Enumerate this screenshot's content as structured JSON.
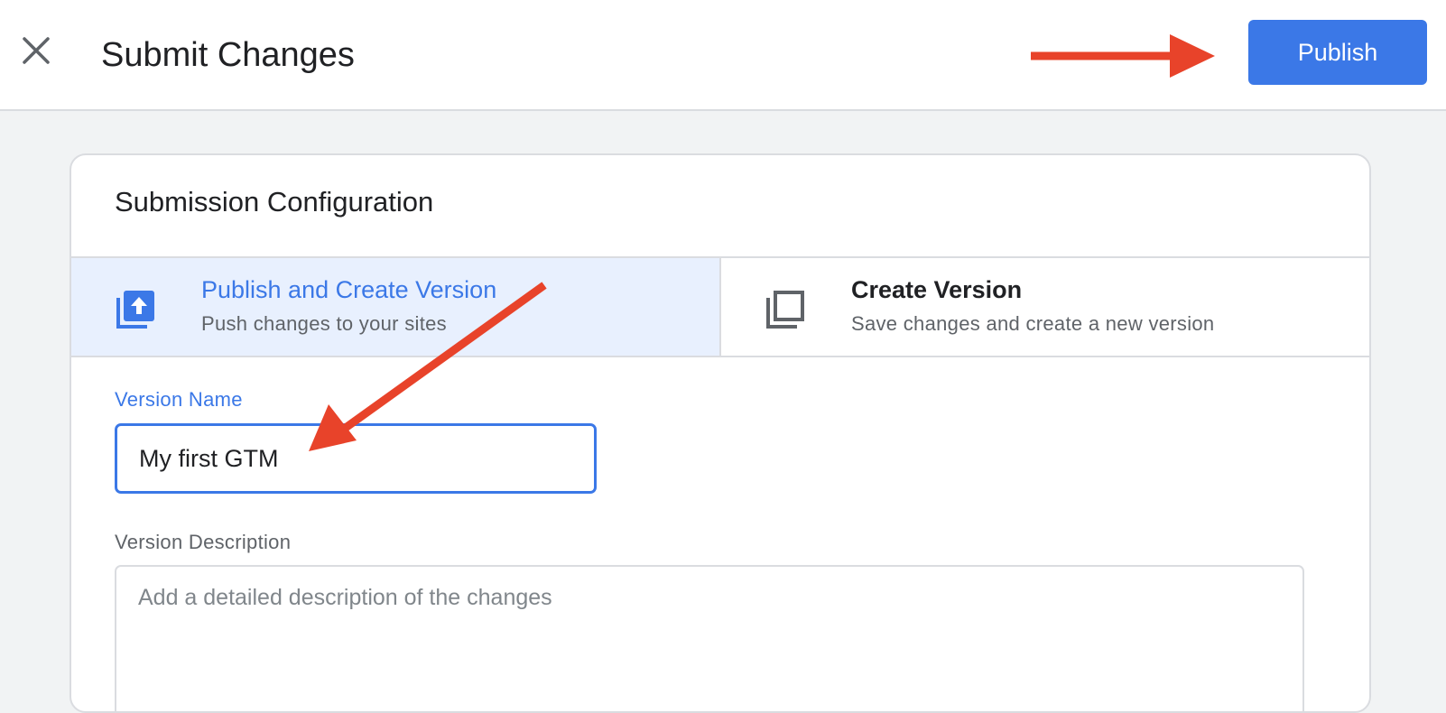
{
  "header": {
    "title": "Submit Changes",
    "publish_label": "Publish"
  },
  "card": {
    "title": "Submission Configuration",
    "options": [
      {
        "title": "Publish and Create Version",
        "subtitle": "Push changes to your sites",
        "selected": true,
        "icon": "publish-upload-icon"
      },
      {
        "title": "Create Version",
        "subtitle": "Save changes and create a new version",
        "selected": false,
        "icon": "copy-version-icon"
      }
    ],
    "version_name": {
      "label": "Version Name",
      "value": "My first GTM"
    },
    "version_description": {
      "label": "Version Description",
      "placeholder": "Add a detailed description of the changes",
      "value": ""
    }
  },
  "colors": {
    "accent": "#3b78e7",
    "selected_bg": "#e8f0fe",
    "annotation": "#e8432a",
    "page_bg": "#f1f3f4"
  },
  "icons": {
    "close": "close-icon",
    "annotation_arrows": "red-arrow-annotation"
  }
}
